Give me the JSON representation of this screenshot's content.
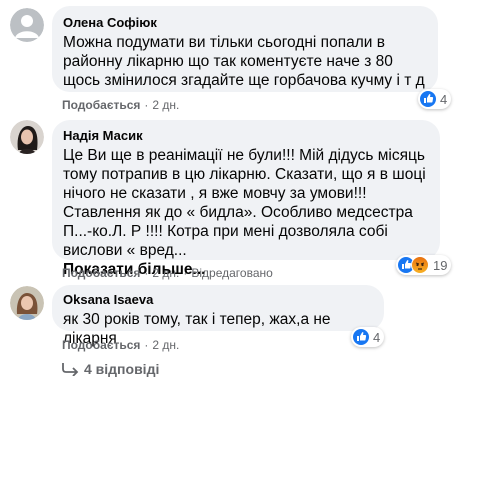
{
  "comments": [
    {
      "author": "Олена Софіюк",
      "text": "Можна подумати ви тільки сьогодні попали в районну лікарню що так коментуєте наче з 80 щось змінилося згадайте ще горбачова кучму і т д",
      "like_label": "Подобається",
      "time": "2 дн.",
      "reactions_count": "4"
    },
    {
      "author": "Надія Масик",
      "text": "Це Ви ще в реанімації не були!!! Мій дідусь місяць тому потрапив в цю лікарню. Сказати, що я в шоці нічого не сказати , я вже мовчу за умови!!! Ставлення як до « бидла». Особливо медсестра П...-ко.Л. Р !!!! Котра при мені дозволяла собі вислови « вред...",
      "see_more": "Показати більше...",
      "like_label": "Подобається",
      "time": "2 дн.",
      "edited": "Відредаговано",
      "reactions_count": "19"
    },
    {
      "author": "Oksana Isaeva",
      "text": "як 30 років тому, так і тепер, жах,а не лікарня",
      "like_label": "Подобається",
      "time": "2 дн.",
      "reactions_count": "4"
    }
  ],
  "replies_label": "4 відповіді",
  "icons": {
    "like": "like-icon",
    "angry": "angry-icon",
    "reply_arrow": "reply-arrow-icon"
  },
  "colors": {
    "bubble": "#f0f2f5",
    "muted": "#65676b",
    "like_blue": "#1877f2",
    "angry_orange": "#e9710f"
  }
}
